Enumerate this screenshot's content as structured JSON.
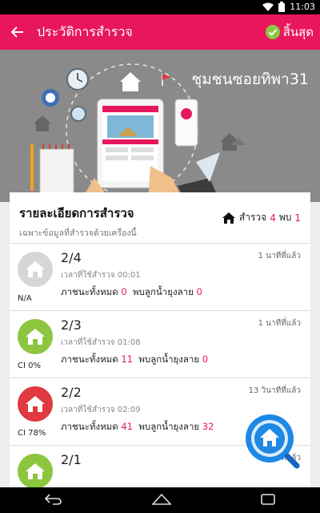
{
  "status_bar": {
    "time": "11:03"
  },
  "app_bar": {
    "title": "ประวัติการสำรวจ",
    "done_label": "สิ้นสุด"
  },
  "hero": {
    "community_name": "ชุมชนซอยทิพา31"
  },
  "summary_card": {
    "title": "รายละเอียดการสำรวจ",
    "subtitle": "เฉพาะข้อมูลที่สำรวจด้วยเครื่องนี้",
    "survey_label": "สำรวจ",
    "survey_count": "4",
    "found_label": "พบ",
    "found_count": "1"
  },
  "labels": {
    "duration_prefix": "เวลาที่ใช้สำรวจ",
    "containers_label": "ภาชนะทั้งหมด",
    "larvae_label": "พบลูกน้ำยุงลาย"
  },
  "records": [
    {
      "code": "2/4",
      "time_ago": "1 นาทีที่แล้ว",
      "duration": "00:01",
      "containers": "0",
      "larvae": "0",
      "ci": "N/A",
      "status_color": "#d6d6d6"
    },
    {
      "code": "2/3",
      "time_ago": "1 นาทีที่แล้ว",
      "duration": "01:08",
      "containers": "11",
      "larvae": "0",
      "ci": "CI 0%",
      "status_color": "#8cc63f"
    },
    {
      "code": "2/2",
      "time_ago": "13 วินาทีที่แล้ว",
      "duration": "02:09",
      "containers": "41",
      "larvae": "32",
      "ci": "CI 78%",
      "status_color": "#e0393e"
    },
    {
      "code": "2/1",
      "time_ago": "2 นาทีที่แล้ว",
      "duration": "",
      "containers": "",
      "larvae": "",
      "ci": "",
      "status_color": "#8cc63f"
    }
  ],
  "colors": {
    "accent": "#e8175d",
    "fab": "#1e88e5"
  }
}
